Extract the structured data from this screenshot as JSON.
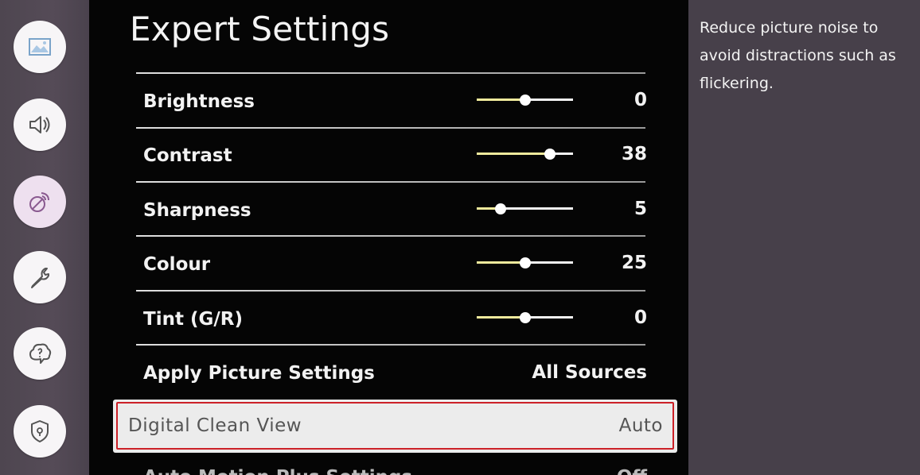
{
  "rail": {
    "icons": [
      "picture-icon",
      "sound-icon",
      "broadcasting-icon",
      "general-icon",
      "support-icon",
      "privacy-icon"
    ]
  },
  "panel": {
    "title": "Expert Settings",
    "rows": [
      {
        "label": "Brightness",
        "value": "0",
        "level": 0.5
      },
      {
        "label": "Contrast",
        "value": "38",
        "level": 0.76
      },
      {
        "label": "Sharpness",
        "value": "5",
        "level": 0.25
      },
      {
        "label": "Colour",
        "value": "25",
        "level": 0.5
      },
      {
        "label": "Tint (G/R)",
        "value": "0",
        "level": 0.5
      }
    ],
    "apply": {
      "label": "Apply Picture Settings",
      "value": "All Sources"
    },
    "focused": {
      "label": "Digital Clean View",
      "value": "Auto"
    },
    "partial": {
      "label": "Auto Motion Plus Settings",
      "value": "Off"
    }
  },
  "help": {
    "text": "Reduce picture noise to avoid distractions such as flickering."
  },
  "colors": {
    "panel_bg": "#050505",
    "rail_bg": "#4e4650",
    "focus_border": "#cc2128",
    "slider_fill": "#f0ea9c"
  }
}
